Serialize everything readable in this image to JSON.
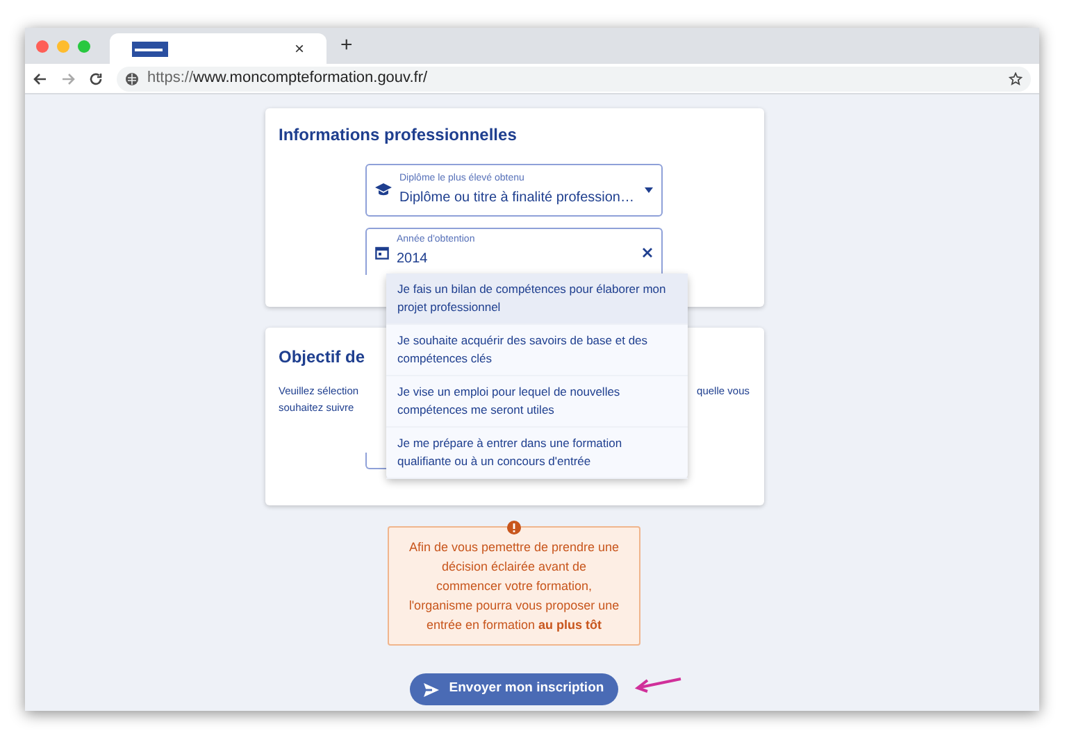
{
  "browser": {
    "tab_close": "×",
    "new_tab": "+",
    "url_prefix": "https://",
    "url_host": "www.moncompteformation.gouv.fr/"
  },
  "professional_info": {
    "title": "Informations professionnelles",
    "diploma_field": {
      "label": "Diplôme le plus élevé obtenu",
      "value": "Diplôme ou titre à finalité profession…"
    },
    "year_field": {
      "label": "Année d'obtention",
      "value": "2014"
    }
  },
  "objective": {
    "title": "Objectif de",
    "text_left": [
      "Veuillez sélection",
      "souhaitez suivre"
    ],
    "text_right": "quelle vous"
  },
  "dropdown": [
    {
      "label": "Je fais un bilan de compétences pour élaborer mon projet professionnel",
      "selected": true
    },
    {
      "label": "Je souhaite acquérir des savoirs de base et des compétences clés",
      "selected": false
    },
    {
      "label": "Je vise un emploi pour lequel de nouvelles compétences me seront utiles",
      "selected": false
    },
    {
      "label": "Je me prépare à entrer dans une formation qualifiante ou à un concours d'entrée",
      "selected": false
    }
  ],
  "notice": {
    "text": "Afin de vous pemettre de prendre une décision éclairée avant de commencer votre formation, l'organisme pourra vous proposer une entrée en formation **au plus tôt**"
  },
  "submit_button": "Envoyer mon inscription"
}
